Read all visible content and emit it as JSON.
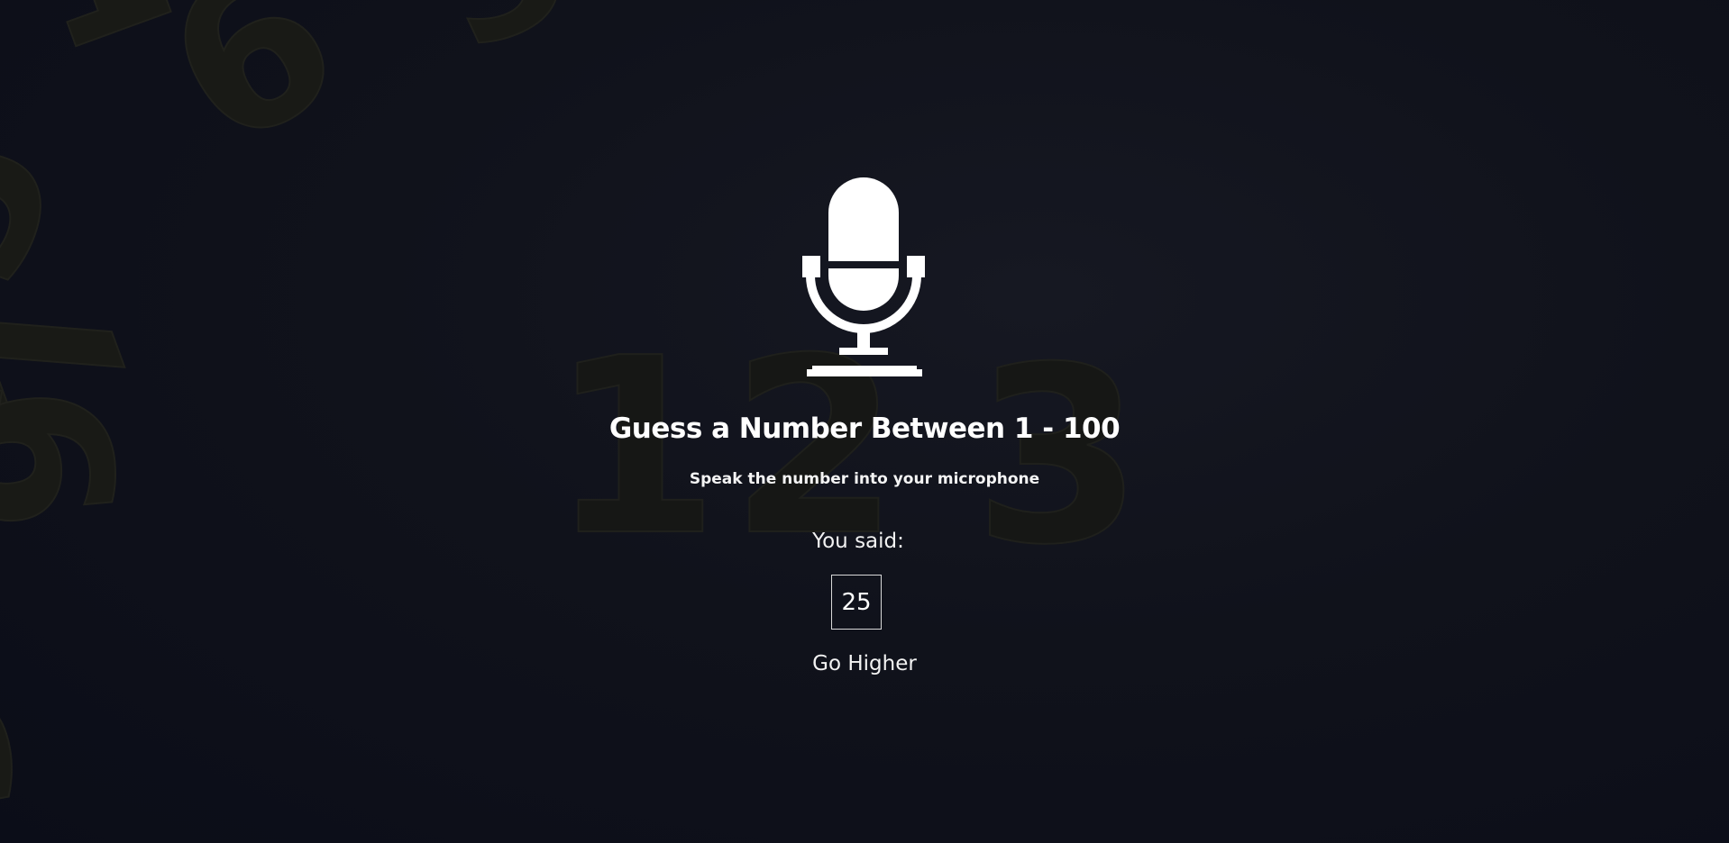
{
  "game": {
    "title": "Guess a Number Between 1 - 100",
    "subtitle": "Speak the number into your microphone",
    "you_said_label": "You said:",
    "guess_value": "25",
    "hint": "Go Higher"
  },
  "icons": {
    "microphone": "microphone-icon"
  },
  "colors": {
    "background": "#0f111b",
    "text": "#ffffff",
    "decor_digits": "#1a1b17"
  }
}
